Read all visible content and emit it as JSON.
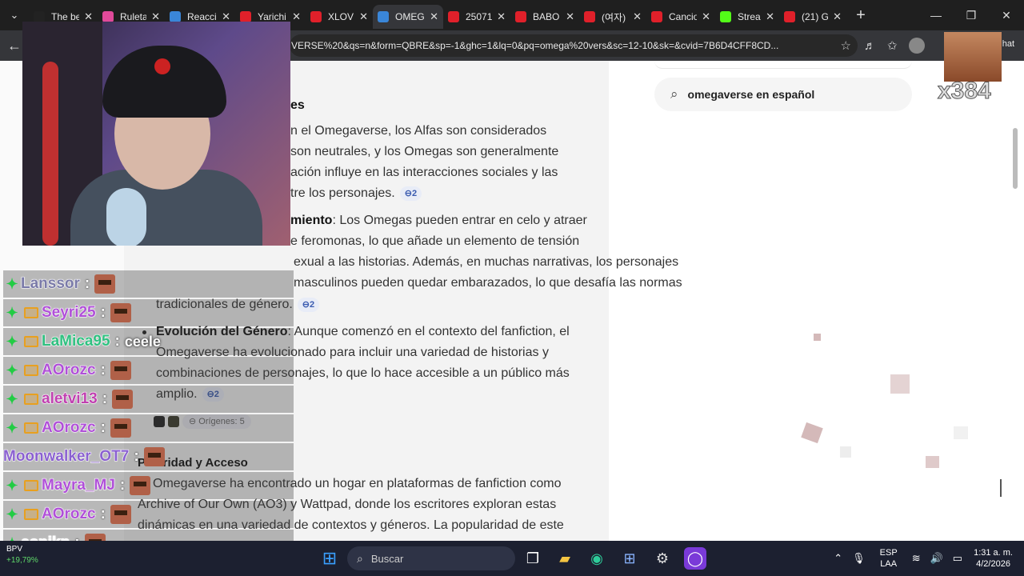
{
  "browser": {
    "tabs": [
      {
        "title": "The be",
        "fav_color": "#222222"
      },
      {
        "title": "Ruleta",
        "fav_color": "#e04a9a"
      },
      {
        "title": "Reacci",
        "fav_color": "#3a86d8"
      },
      {
        "title": "Yarichi",
        "fav_color": "#e0202a"
      },
      {
        "title": "XLOV",
        "fav_color": "#e0202a"
      },
      {
        "title": "OMEG",
        "fav_color": "#3a86d8"
      },
      {
        "title": "25071",
        "fav_color": "#e0202a"
      },
      {
        "title": "BABO",
        "fav_color": "#e0202a"
      },
      {
        "title": "(여자)",
        "fav_color": "#e0202a"
      },
      {
        "title": "Cancio",
        "fav_color": "#e0202a"
      },
      {
        "title": "Stream",
        "fav_color": "#53fc18"
      },
      {
        "title": "(21) G",
        "fav_color": "#e0202a"
      }
    ],
    "new_tab": "+",
    "url": "VERSE%20&qs=n&form=QBRE&sp=-1&ghc=1&lq=0&pq=omega%20vers&sc=12-10&sk=&cvid=7B6D4CFF8CD...",
    "chat_label": "hat"
  },
  "page": {
    "search_query": "omegaverse en español",
    "heading_partial": "es",
    "lines": [
      "n el Omegaverse, los Alfas son considerados",
      "son neutrales, y los Omegas son generalmente",
      "ación influye en las interacciones sociales y las",
      "tre los personajes."
    ],
    "cite1": "2",
    "bullet2_bold": "miento",
    "bullet2_lines": [
      ": Los Omegas pueden entrar en celo y atraer",
      "e feromonas, lo que añade un elemento de tensión",
      "exual a las historias. Además, en muchas narrativas, los personajes",
      "masculinos pueden quedar embarazados, lo que desafía las normas",
      "tradicionales de género."
    ],
    "cite2": "2",
    "bullet3_bold": "Evolución del Género",
    "bullet3_lines": [
      ": Aunque comenzó en el contexto del fanfiction, el",
      "Omegaverse ha evolucionado para incluir una variedad de historias y",
      "combinaciones de personajes, lo que lo hace accesible a un público más",
      "amplio."
    ],
    "cite3": "2",
    "origins_label": "Orígenes: 5",
    "section2_title": "laridad y Acceso",
    "section2_title_prefix": "Po",
    "section2_lines": [
      "Omegaverse ha encontrado un hogar en plataformas de fanfiction como",
      "Archive of Our Own (AO3) y Wattpad, donde los escritores exploran estas",
      "dinámicas en una variedad de contextos y géneros. La popularidad de este"
    ]
  },
  "overlay": {
    "multiplier": "x384",
    "chat": [
      {
        "name": "Lanssor",
        "color": "#7a7aa8",
        "msg": "",
        "crown": false
      },
      {
        "name": "Seyri25",
        "color": "#b050d8",
        "msg": "",
        "crown": true
      },
      {
        "name": "LaMica95",
        "color": "#30c080",
        "msg": "ceele",
        "crown": true
      },
      {
        "name": "AOrozc",
        "color": "#b050d8",
        "msg": "",
        "crown": true
      },
      {
        "name": "aletvi13",
        "color": "#c040b0",
        "msg": "",
        "crown": true
      },
      {
        "name": "AOrozc",
        "color": "#b050d8",
        "msg": "",
        "crown": true
      },
      {
        "name": "Moonwalker_OT7",
        "color": "#8a60d0",
        "msg": "",
        "crown": false
      },
      {
        "name": "Mayra_MJ",
        "color": "#b050d8",
        "msg": "",
        "crown": true
      },
      {
        "name": "AOrozc",
        "color": "#b050d8",
        "msg": "",
        "crown": true
      },
      {
        "name": "conikp",
        "color": "#ffffff",
        "msg": "",
        "crown": false
      }
    ]
  },
  "taskbar": {
    "search_label": "Buscar",
    "stock_name": "BPV",
    "stock_change": "+19,79%",
    "lang_top": "ESP",
    "lang_bottom": "LAA",
    "time": "1:31 a. m.",
    "date": "4/2/2026"
  }
}
